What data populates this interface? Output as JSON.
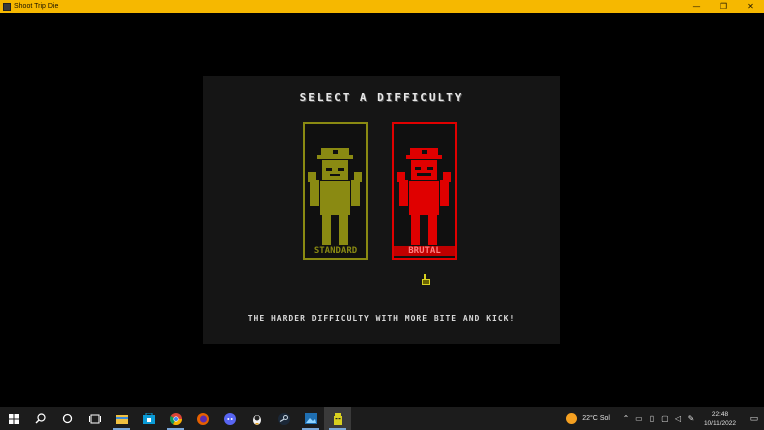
{
  "window": {
    "title": "Shoot Trip Die",
    "minimize_glyph": "—",
    "maximize_glyph": "❐",
    "close_glyph": "✕"
  },
  "game": {
    "heading": "SELECT A DIFFICULTY",
    "options": [
      {
        "label": "STANDARD",
        "color": "#8a8a12",
        "selected": false
      },
      {
        "label": "BRUTAL",
        "color": "#e00000",
        "selected": true
      }
    ],
    "description": "THE HARDER DIFFICULTY WITH MORE BITE AND KICK!"
  },
  "taskbar": {
    "apps": [
      "start-icon",
      "search-icon",
      "cortana-icon",
      "task-view-icon",
      "file-explorer-icon",
      "store-icon",
      "chrome-icon",
      "firefox-icon",
      "discord-icon",
      "penguin-app-icon",
      "steam-icon",
      "photos-icon",
      "shoot-trip-die-icon"
    ],
    "weather_temp": "22°C",
    "weather_text": "Sol",
    "time": "22:48",
    "date": "10/11/2022"
  }
}
